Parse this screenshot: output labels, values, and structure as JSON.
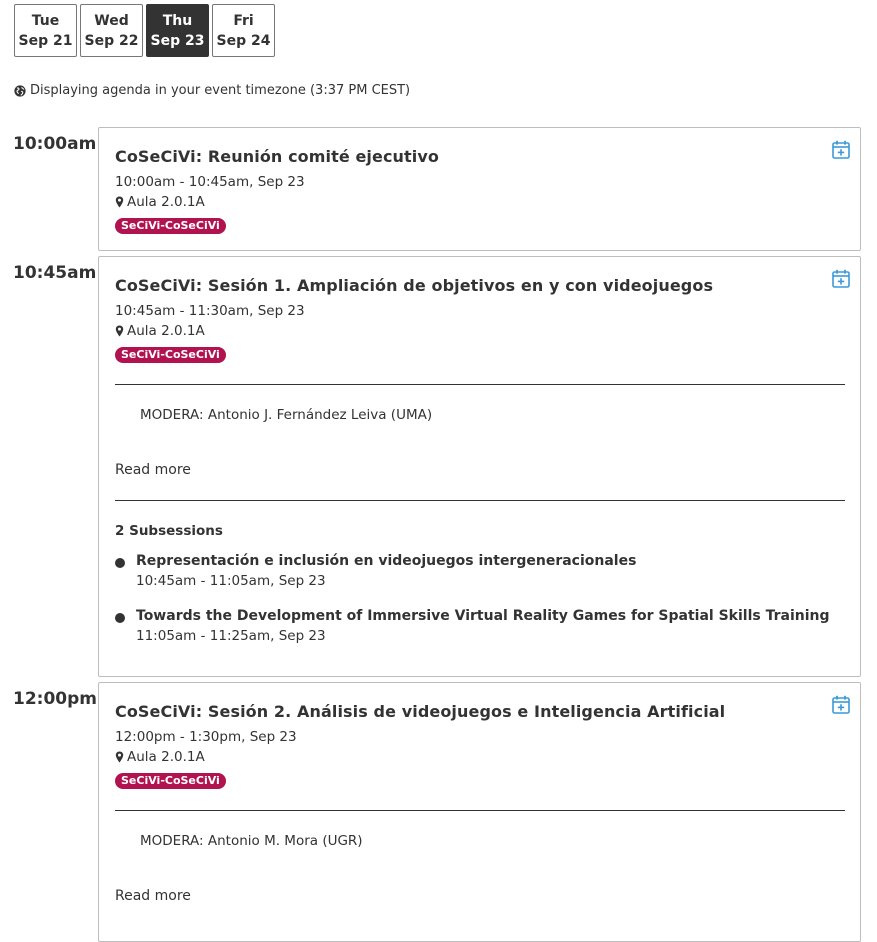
{
  "days": [
    {
      "dow": "Tue",
      "date": "Sep 21"
    },
    {
      "dow": "Wed",
      "date": "Sep 22"
    },
    {
      "dow": "Thu",
      "date": "Sep 23"
    },
    {
      "dow": "Fri",
      "date": "Sep 24"
    }
  ],
  "timezone_note": "Displaying agenda in your event timezone (3:37 PM CEST)",
  "slots": [
    {
      "time": "10:00am",
      "title": "CoSeCiVi: Reunión comité ejecutivo",
      "when": "10:00am - 10:45am, Sep 23",
      "location": "Aula 2.0.1A",
      "tag": "SeCiVi-CoSeCiVi"
    },
    {
      "time": "10:45am",
      "title": "CoSeCiVi: Sesión 1. Ampliación de objetivos en y con videojuegos",
      "when": "10:45am - 11:30am, Sep 23",
      "location": "Aula 2.0.1A",
      "tag": "SeCiVi-CoSeCiVi",
      "moderator": "MODERA: Antonio J. Fernández Leiva (UMA)",
      "read_more": "Read more",
      "subsessions_heading": "2 Subsessions",
      "subsessions": [
        {
          "title": "Representación e inclusión en videojuegos intergeneracionales",
          "when": "10:45am - 11:05am, Sep 23"
        },
        {
          "title": "Towards the Development of Immersive Virtual Reality Games for Spatial Skills Training",
          "when": "11:05am - 11:25am, Sep 23"
        }
      ]
    },
    {
      "time": "12:00pm",
      "title": "CoSeCiVi: Sesión 2. Análisis de videojuegos e Inteligencia Artificial",
      "when": "12:00pm - 1:30pm, Sep 23",
      "location": "Aula 2.0.1A",
      "tag": "SeCiVi-CoSeCiVi",
      "moderator": "MODERA: Antonio M. Mora (UGR)",
      "read_more": "Read more"
    }
  ],
  "colors": {
    "tag": "#b0134f",
    "calendar_icon": "#3a9ad9",
    "active_tab": "#333333"
  },
  "icons": {
    "timezone": "globe-icon",
    "location": "map-pin-icon",
    "add_calendar": "calendar-plus-icon",
    "bullet": "bullet-dot"
  }
}
